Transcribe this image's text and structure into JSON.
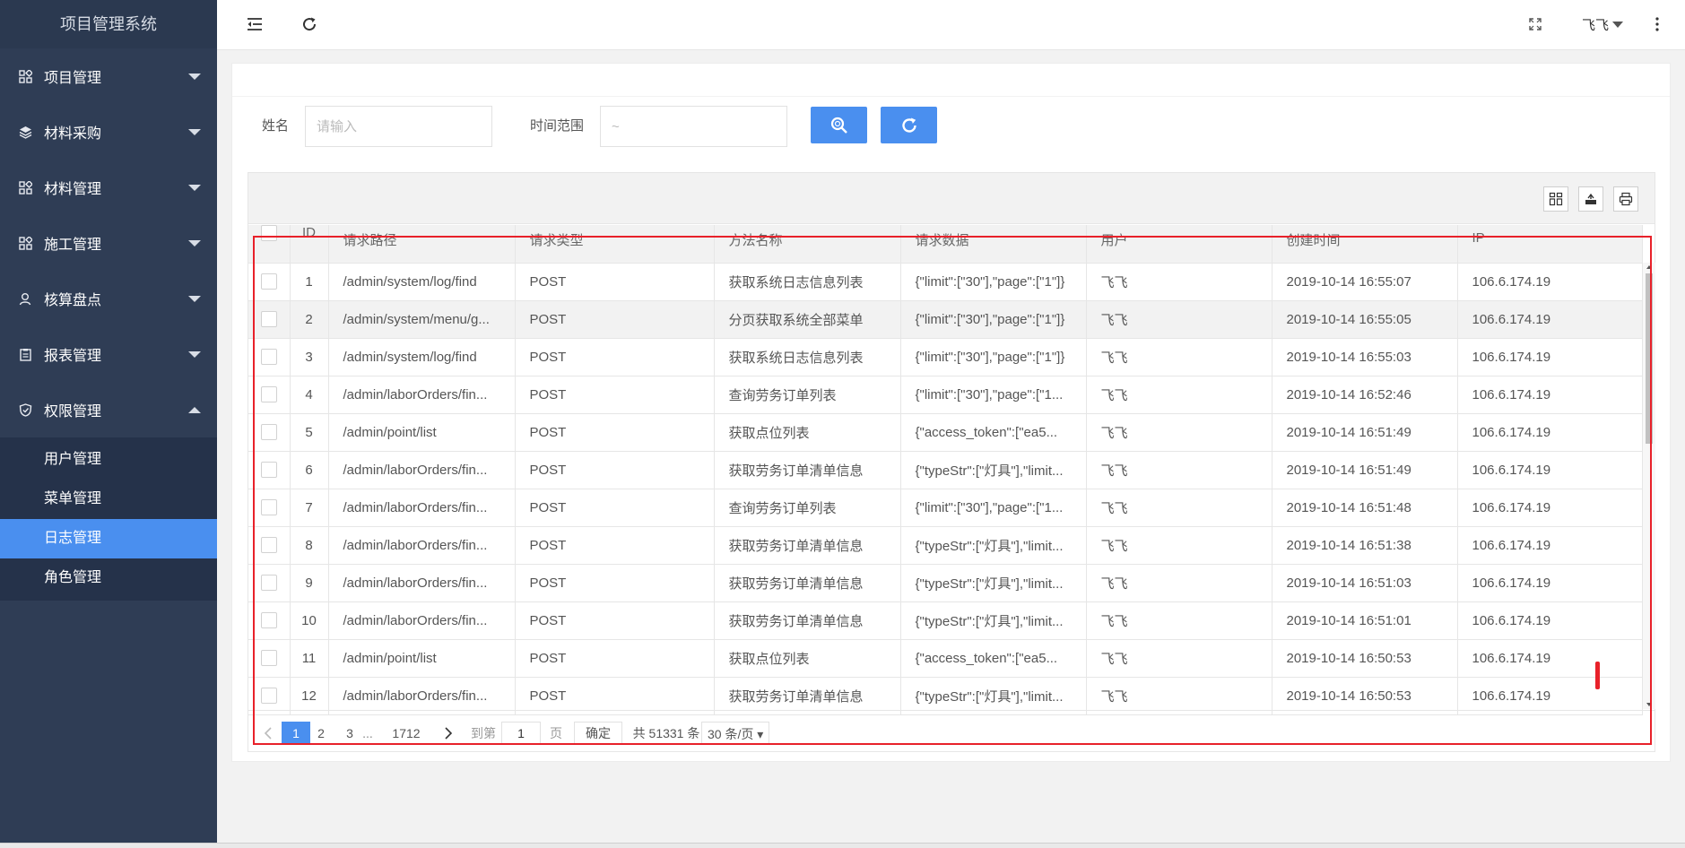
{
  "app": {
    "title": "项目管理系统"
  },
  "sidebar": {
    "items": [
      {
        "label": "项目管理",
        "icon": "dashboard-icon"
      },
      {
        "label": "材料采购",
        "icon": "layers-icon"
      },
      {
        "label": "材料管理",
        "icon": "dashboard-icon"
      },
      {
        "label": "施工管理",
        "icon": "dashboard-icon"
      },
      {
        "label": "核算盘点",
        "icon": "user-icon"
      },
      {
        "label": "报表管理",
        "icon": "clipboard-icon"
      },
      {
        "label": "权限管理",
        "icon": "shield-check-icon"
      }
    ],
    "submenu": [
      {
        "label": "用户管理"
      },
      {
        "label": "菜单管理"
      },
      {
        "label": "日志管理",
        "active": true
      },
      {
        "label": "角色管理"
      }
    ]
  },
  "header": {
    "user": "飞飞",
    "icons": [
      "menu-fold-icon",
      "refresh-icon",
      "fullscreen-icon",
      "more-vertical-icon"
    ]
  },
  "filters": {
    "name_label": "姓名",
    "name_placeholder": "请输入",
    "time_label": "时间范围",
    "time_placeholder": "~"
  },
  "table": {
    "columns": [
      "ID",
      "请求路径",
      "请求类型",
      "方法名称",
      "请求数据",
      "用户",
      "创建时间",
      "IP"
    ],
    "rows": [
      {
        "id": "1",
        "path": "/admin/system/log/find",
        "type": "POST",
        "method": "获取系统日志信息列表",
        "data": "{\"limit\":[\"30\"],\"page\":[\"1\"]}",
        "user": "飞飞",
        "time": "2019-10-14 16:55:07",
        "ip": "106.6.174.19"
      },
      {
        "id": "2",
        "path": "/admin/system/menu/g...",
        "type": "POST",
        "method": "分页获取系统全部菜单",
        "data": "{\"limit\":[\"30\"],\"page\":[\"1\"]}",
        "user": "飞飞",
        "time": "2019-10-14 16:55:05",
        "ip": "106.6.174.19"
      },
      {
        "id": "3",
        "path": "/admin/system/log/find",
        "type": "POST",
        "method": "获取系统日志信息列表",
        "data": "{\"limit\":[\"30\"],\"page\":[\"1\"]}",
        "user": "飞飞",
        "time": "2019-10-14 16:55:03",
        "ip": "106.6.174.19"
      },
      {
        "id": "4",
        "path": "/admin/laborOrders/fin...",
        "type": "POST",
        "method": "查询劳务订单列表",
        "data": "{\"limit\":[\"30\"],\"page\":[\"1...",
        "user": "飞飞",
        "time": "2019-10-14 16:52:46",
        "ip": "106.6.174.19"
      },
      {
        "id": "5",
        "path": "/admin/point/list",
        "type": "POST",
        "method": "获取点位列表",
        "data": "{\"access_token\":[\"ea5...",
        "user": "飞飞",
        "time": "2019-10-14 16:51:49",
        "ip": "106.6.174.19"
      },
      {
        "id": "6",
        "path": "/admin/laborOrders/fin...",
        "type": "POST",
        "method": "获取劳务订单清单信息",
        "data": "{\"typeStr\":[\"灯具\"],\"limit...",
        "user": "飞飞",
        "time": "2019-10-14 16:51:49",
        "ip": "106.6.174.19"
      },
      {
        "id": "7",
        "path": "/admin/laborOrders/fin...",
        "type": "POST",
        "method": "查询劳务订单列表",
        "data": "{\"limit\":[\"30\"],\"page\":[\"1...",
        "user": "飞飞",
        "time": "2019-10-14 16:51:48",
        "ip": "106.6.174.19"
      },
      {
        "id": "8",
        "path": "/admin/laborOrders/fin...",
        "type": "POST",
        "method": "获取劳务订单清单信息",
        "data": "{\"typeStr\":[\"灯具\"],\"limit...",
        "user": "飞飞",
        "time": "2019-10-14 16:51:38",
        "ip": "106.6.174.19"
      },
      {
        "id": "9",
        "path": "/admin/laborOrders/fin...",
        "type": "POST",
        "method": "获取劳务订单清单信息",
        "data": "{\"typeStr\":[\"灯具\"],\"limit...",
        "user": "飞飞",
        "time": "2019-10-14 16:51:03",
        "ip": "106.6.174.19"
      },
      {
        "id": "10",
        "path": "/admin/laborOrders/fin...",
        "type": "POST",
        "method": "获取劳务订单清单信息",
        "data": "{\"typeStr\":[\"灯具\"],\"limit...",
        "user": "飞飞",
        "time": "2019-10-14 16:51:01",
        "ip": "106.6.174.19"
      },
      {
        "id": "11",
        "path": "/admin/point/list",
        "type": "POST",
        "method": "获取点位列表",
        "data": "{\"access_token\":[\"ea5...",
        "user": "飞飞",
        "time": "2019-10-14 16:50:53",
        "ip": "106.6.174.19"
      },
      {
        "id": "12",
        "path": "/admin/laborOrders/fin...",
        "type": "POST",
        "method": "获取劳务订单清单信息",
        "data": "{\"typeStr\":[\"灯具\"],\"limit...",
        "user": "飞飞",
        "time": "2019-10-14 16:50:53",
        "ip": "106.6.174.19"
      }
    ]
  },
  "pagination": {
    "current": "1",
    "pages": [
      "2",
      "3"
    ],
    "ellipsis": "...",
    "last": "1712",
    "goto_label": "到第",
    "goto_value": "1",
    "page_unit": "页",
    "confirm": "确定",
    "total": "共 51331 条",
    "page_size": "30 条/页"
  },
  "colors": {
    "sidebar": "#2f3d55",
    "accent": "#4a8fef",
    "highlight": "#e8212a"
  }
}
